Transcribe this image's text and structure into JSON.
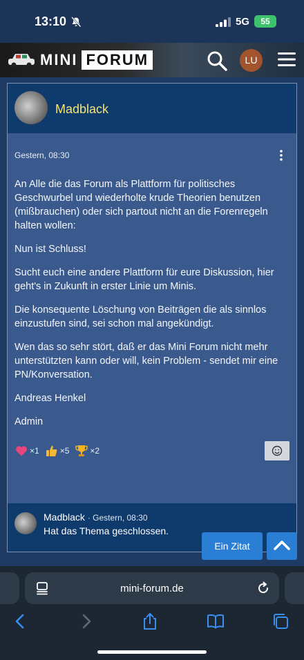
{
  "status": {
    "time": "13:10",
    "network": "5G",
    "battery": "55"
  },
  "header": {
    "logo_left": "MINI",
    "logo_right": "FORUM",
    "user_initials": "LU"
  },
  "post": {
    "author": "Madblack",
    "date": "Gestern, 08:30",
    "paragraphs": [
      "An Alle die das Forum als Plattform für politisches Geschwurbel und wiederholte krude Theorien benutzen (mißbrauchen) oder sich partout nicht an die Forenregeln halten wollen:",
      "Nun ist Schluss!",
      "Sucht euch eine andere Plattform für eure Diskussion, hier geht's in Zukunft in erster Linie um Minis.",
      "Die konsequente Löschung von Beiträgen die als sinnlos einzustufen sind, sei schon mal angekündigt.",
      "Wen das so sehr stört, daß er das Mini Forum nicht mehr unterstützten kann oder will, kein Problem - sendet mir eine PN/Konversation.",
      "Andreas Henkel",
      "Admin"
    ],
    "reactions": [
      {
        "icon": "heart-icon",
        "count": "×1"
      },
      {
        "icon": "thumbs-up-icon",
        "count": "×5"
      },
      {
        "icon": "trophy-icon",
        "count": "×2"
      }
    ]
  },
  "reply": {
    "author": "Madblack",
    "date": "· Gestern, 08:30",
    "text": "Hat das Thema geschlossen."
  },
  "actions": {
    "quote_label": "Ein Zitat"
  },
  "browser": {
    "url": "mini-forum.de"
  },
  "colors": {
    "accent": "#2a7fd4",
    "author": "#f2e37a",
    "card": "#3a5a8e",
    "card_header": "#0f3a6c"
  }
}
